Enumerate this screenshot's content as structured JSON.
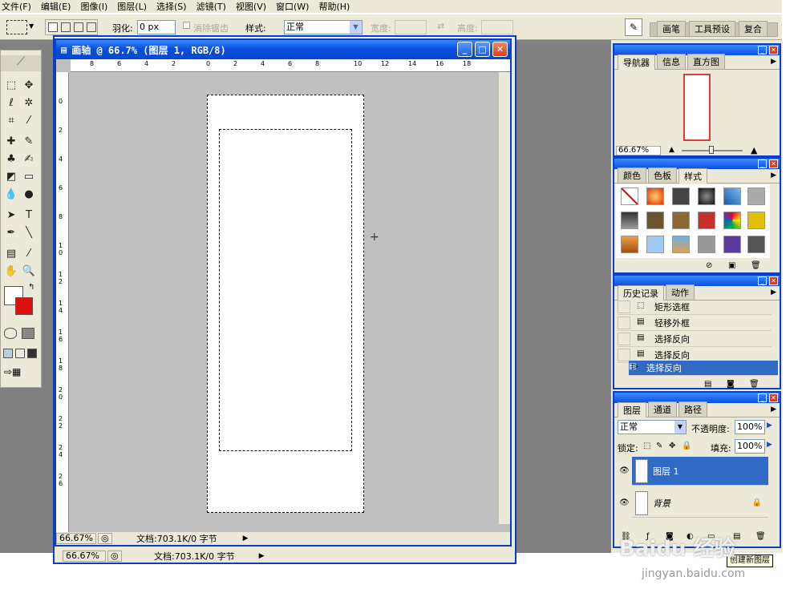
{
  "menu": [
    "文件(F)",
    "编辑(E)",
    "图像(I)",
    "图层(L)",
    "选择(S)",
    "滤镜(T)",
    "视图(V)",
    "窗口(W)",
    "帮助(H)"
  ],
  "options": {
    "feather_label": "羽化:",
    "feather_value": "0 px",
    "antialias_label": "消除锯齿",
    "style_label": "样式:",
    "style_value": "正常",
    "width_label": "宽度:",
    "height_label": "高度:",
    "well_tabs": [
      "画笔",
      "工具预设",
      "复合"
    ]
  },
  "document": {
    "title": "画轴 @ 66.7% (图层 1, RGB/8)",
    "zoom": "66.67%",
    "doc_info": "文档:703.1K/0 字节",
    "h_ruler": [
      "8",
      "6",
      "4",
      "2",
      "0",
      "2",
      "4",
      "6",
      "8",
      "10",
      "12",
      "14",
      "16",
      "18"
    ],
    "v_ruler": [
      "0",
      "2",
      "4",
      "6",
      "8",
      "1 0",
      "1 2",
      "1 4",
      "1 6",
      "1 8",
      "2 0",
      "2 2",
      "2 4",
      "2 6"
    ]
  },
  "status_back": {
    "zoom": "66.67%",
    "doc_info": "文档:703.1K/0 字节"
  },
  "navigator": {
    "tabs": [
      "导航器",
      "信息",
      "直方图"
    ],
    "zoom": "66.67%"
  },
  "swatches": {
    "tabs": [
      "颜色",
      "色板",
      "样式"
    ]
  },
  "history": {
    "tabs": [
      "历史记录",
      "动作"
    ],
    "items": [
      "矩形选框",
      "轻移外框",
      "选择反向",
      "选择反向",
      "选择反向"
    ]
  },
  "layers": {
    "tabs": [
      "图层",
      "通道",
      "路径"
    ],
    "blend": "正常",
    "opacity_label": "不透明度:",
    "opacity": "100%",
    "lock_label": "锁定:",
    "fill_label": "填充:",
    "fill": "100%",
    "items": [
      "图层 1",
      "背景"
    ],
    "new_layer_tip": "创建新图层"
  },
  "watermark": {
    "brand": "Baidu 经验",
    "url": "jingyan.baidu.com"
  },
  "colors": {
    "accent": "#0a3fc4",
    "selection": "#316ac5",
    "fg": "#ffffff",
    "bg": "#e01010"
  }
}
